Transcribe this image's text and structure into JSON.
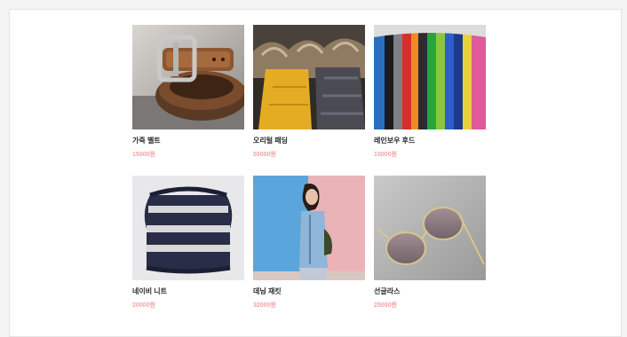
{
  "products": [
    {
      "name": "가죽 벨트",
      "price": "15000원",
      "image": "belt-photo"
    },
    {
      "name": "오리털 패딩",
      "price": "55000원",
      "image": "padded-jacket-photo"
    },
    {
      "name": "레인보우 후드",
      "price": "15000원",
      "image": "colorful-hoodies-photo"
    },
    {
      "name": "네이비 니트",
      "price": "20000원",
      "image": "navy-knit-photo"
    },
    {
      "name": "데님 재킷",
      "price": "32000원",
      "image": "denim-jacket-photo"
    },
    {
      "name": "선글라스",
      "price": "25000원",
      "image": "sunglasses-photo"
    }
  ],
  "colors": {
    "price": "#f4a3a3",
    "name": "#2a2a2a",
    "page_bg": "#f3f3f3",
    "panel_bg": "#ffffff"
  }
}
